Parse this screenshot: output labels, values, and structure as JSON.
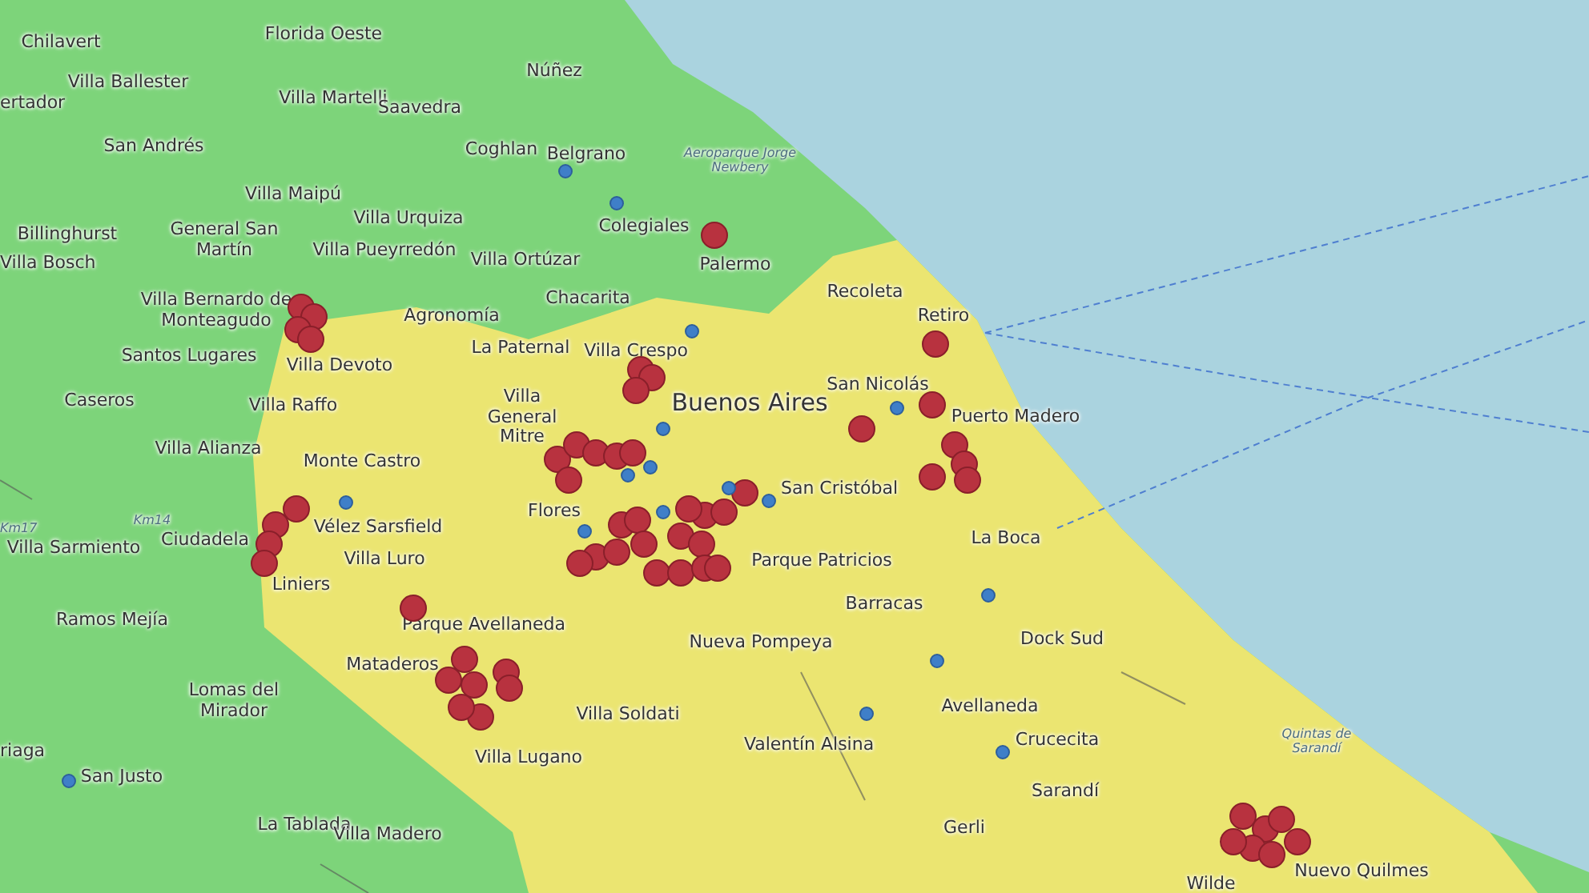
{
  "map": {
    "regions": [
      {
        "kind": "province",
        "color": "#7dd47a"
      },
      {
        "kind": "city",
        "color": "#ebe571"
      }
    ],
    "labels": [
      "Chilavert",
      "Florida Oeste",
      "Villa Ballester",
      "ertador",
      "Villa Martelli",
      "Saavedra",
      "Núñez",
      "San Andrés",
      "Coghlan",
      "Belgrano",
      "Aeroparque Jorge Newbery",
      "Villa Maipú",
      "Billinghurst",
      "General San Martín",
      "Villa Bosch",
      "Villa Urquiza",
      "Colegiales",
      "Villa Pueyrredón",
      "Villa Ortúzar",
      "Palermo",
      "Villa Bernardo de Monteagudo",
      "Agronomía",
      "Chacarita",
      "Recoleta",
      "Retiro",
      "Santos Lugares",
      "Villa Devoto",
      "La Paternal",
      "Villa Crespo",
      "San Nicolás",
      "Caseros",
      "Villa Raffo",
      "Villa General Mitre",
      "Buenos Aires",
      "Puerto Madero",
      "Villa Alianza",
      "Monte Castro",
      "San Cristóbal",
      "Km17",
      "Km14",
      "Vélez Sarsfield",
      "Flores",
      "Villa Sarmiento",
      "Ciudadela",
      "Villa Luro",
      "Parque Patricios",
      "La Boca",
      "Liniers",
      "Ramos Mejía",
      "Parque Avellaneda",
      "Barracas",
      "Dock Sud",
      "Nueva Pompeya",
      "Mataderos",
      "Lomas del Mirador",
      "Villa Soldati",
      "Avellaneda",
      "riaga",
      "Valentín Alsina",
      "Crucecita",
      "Quintas de Sarandí",
      "Villa Lugano",
      "San Justo",
      "Sarandí",
      "La Tablada",
      "Villa Madero",
      "Gerli",
      "Wilde",
      "Nuevo Quilmes"
    ],
    "markers": [
      {
        "color": "#b8323f"
      },
      {
        "color": "#b8323f"
      },
      {
        "color": "#b8323f"
      },
      {
        "color": "#b8323f"
      },
      {
        "color": "#b8323f"
      },
      {
        "color": "#b8323f"
      },
      {
        "color": "#b8323f"
      },
      {
        "color": "#b8323f"
      },
      {
        "color": "#b8323f"
      },
      {
        "color": "#b8323f"
      },
      {
        "color": "#b8323f"
      },
      {
        "color": "#b8323f"
      },
      {
        "color": "#b8323f"
      },
      {
        "color": "#b8323f"
      },
      {
        "color": "#b8323f"
      },
      {
        "color": "#b8323f"
      },
      {
        "color": "#b8323f"
      },
      {
        "color": "#b8323f"
      },
      {
        "color": "#b8323f"
      },
      {
        "color": "#b8323f"
      },
      {
        "color": "#b8323f"
      },
      {
        "color": "#b8323f"
      },
      {
        "color": "#b8323f"
      },
      {
        "color": "#b8323f"
      },
      {
        "color": "#b8323f"
      },
      {
        "color": "#b8323f"
      },
      {
        "color": "#b8323f"
      },
      {
        "color": "#b8323f"
      },
      {
        "color": "#b8323f"
      },
      {
        "color": "#b8323f"
      },
      {
        "color": "#b8323f"
      },
      {
        "color": "#b8323f"
      },
      {
        "color": "#b8323f"
      },
      {
        "color": "#b8323f"
      },
      {
        "color": "#b8323f"
      },
      {
        "color": "#b8323f"
      },
      {
        "color": "#b8323f"
      },
      {
        "color": "#b8323f"
      },
      {
        "color": "#b8323f"
      },
      {
        "color": "#b8323f"
      },
      {
        "color": "#b8323f"
      },
      {
        "color": "#b8323f"
      },
      {
        "color": "#b8323f"
      },
      {
        "color": "#b8323f"
      },
      {
        "color": "#b8323f"
      },
      {
        "color": "#b8323f"
      },
      {
        "color": "#b8323f"
      },
      {
        "color": "#b8323f"
      },
      {
        "color": "#b8323f"
      },
      {
        "color": "#b8323f"
      },
      {
        "color": "#b8323f"
      },
      {
        "color": "#b8323f"
      },
      {
        "color": "#b8323f"
      },
      {
        "color": "#b8323f"
      },
      {
        "color": "#b8323f"
      },
      {
        "color": "#b8323f"
      },
      {
        "color": "#3f7fc8"
      },
      {
        "color": "#3f7fc8"
      },
      {
        "color": "#3f7fc8"
      },
      {
        "color": "#3f7fc8"
      },
      {
        "color": "#3f7fc8"
      },
      {
        "color": "#3f7fc8"
      },
      {
        "color": "#3f7fc8"
      },
      {
        "color": "#3f7fc8"
      },
      {
        "color": "#3f7fc8"
      },
      {
        "color": "#3f7fc8"
      },
      {
        "color": "#3f7fc8"
      },
      {
        "color": "#3f7fc8"
      },
      {
        "color": "#3f7fc8"
      },
      {
        "color": "#3f7fc8"
      },
      {
        "color": "#3f7fc8"
      },
      {
        "color": "#3f7fc8"
      },
      {
        "color": "#3f7fc8"
      }
    ]
  }
}
